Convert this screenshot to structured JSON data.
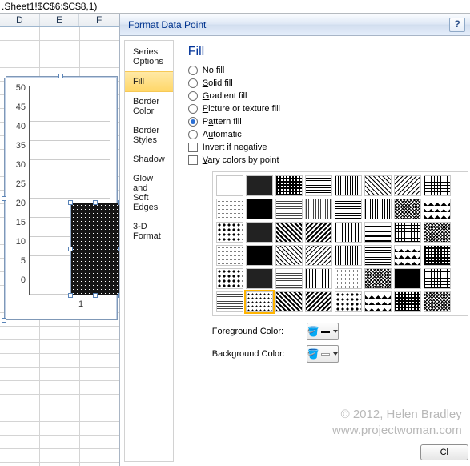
{
  "formula": ".Sheet1!$C$6:$C$8,1)",
  "columns": [
    "D",
    "E",
    "F"
  ],
  "chart_data": {
    "type": "bar",
    "categories": [
      "1"
    ],
    "values": [
      23
    ],
    "title": "",
    "xlabel": "",
    "ylabel": "",
    "ylim": [
      0,
      50
    ],
    "yticks": [
      0,
      5,
      10,
      15,
      20,
      25,
      30,
      35,
      40,
      45,
      50
    ]
  },
  "dialog": {
    "title": "Format Data Point",
    "nav": {
      "items": [
        {
          "label": "Series Options"
        },
        {
          "label": "Fill"
        },
        {
          "label": "Border Color"
        },
        {
          "label": "Border Styles"
        },
        {
          "label": "Shadow"
        },
        {
          "label": "Glow and Soft Edges"
        },
        {
          "label": "3-D Format"
        }
      ],
      "selected_index": 1
    },
    "panel": {
      "heading": "Fill",
      "options": {
        "no_fill": "No fill",
        "solid_fill": "Solid fill",
        "gradient_fill": "Gradient fill",
        "picture_fill": "Picture or texture fill",
        "pattern_fill": "Pattern fill",
        "automatic": "Automatic",
        "invert_negative": "Invert if negative",
        "vary_colors": "Vary colors by point",
        "selected": "pattern_fill"
      },
      "foreground_label": "Foreground Color:",
      "background_label": "Background Color:",
      "foreground_color": "#000000",
      "background_color": "#ffffff",
      "selected_pattern_index": 41
    },
    "close_label": "Cl"
  },
  "watermark": {
    "line1": "© 2012, Helen Bradley",
    "line2": "www.projectwoman.com"
  }
}
